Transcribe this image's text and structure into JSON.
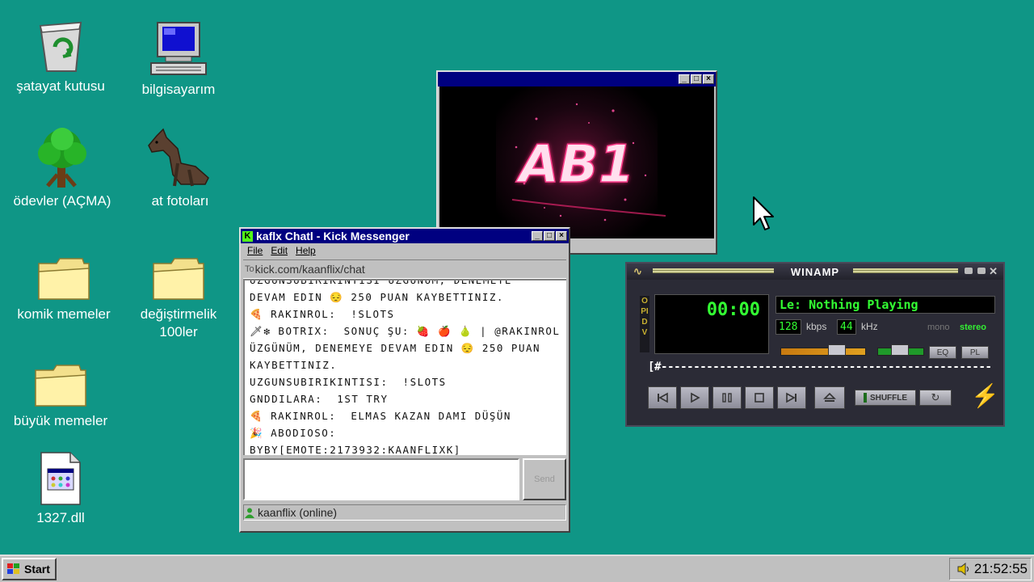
{
  "desktop": {
    "icons": [
      {
        "label": "şatayat kutusu"
      },
      {
        "label": "bilgisayarım"
      },
      {
        "label": "ödevler (AÇMA)"
      },
      {
        "label": "at fotoları"
      },
      {
        "label": "komik memeler"
      },
      {
        "label": "değiştirmelik 100ler"
      },
      {
        "label": "büyük memeler"
      },
      {
        "label": "1327.dll"
      }
    ]
  },
  "video_window": {
    "logo_text": "AB1"
  },
  "chat_window": {
    "title": "kaflx Chatl - Kick Messenger",
    "menu": [
      "File",
      "Edit",
      "Help"
    ],
    "address": "kick.com/kaanflix/chat",
    "messages": [
      "üzgünsübirikintisi üzgünüm, denemeye",
      "devam edin 😔 250 puan kaybettiniz.",
      "🍕 rakinrol:  !slots",
      "🗡❇ botrix:  sonuç şu: 🍓 🍎 🍐 | @rakinrol üzgünüm, denemeye devam edin 😔 250 puan kaybettiniz.",
      "uzgunsubirikintisi:  !slots",
      "gnddilara:  1st try",
      "🍕 rakinrol:  elmas kazan damı düşün",
      "🎉 abodioso:",
      "byby[emote:2173932:kaanflixk]"
    ],
    "send_label": "Send",
    "status_user": "kaanflix (online)"
  },
  "winamp": {
    "title": "WINAMP",
    "side_label": "OPIDV",
    "time": "00:00",
    "track": "Le: Nothing Playing",
    "kbps": "128",
    "kbps_label": "kbps",
    "khz": "44",
    "khz_label": "kHz",
    "mono_label": "mono",
    "stereo_label": "stereo",
    "eq_label": "EQ",
    "pl_label": "PL",
    "seek_text": "[#---------------------------------------------------]",
    "shuffle_label": "SHUFFLE",
    "volume_level": 0.72,
    "balance_level": 0.5,
    "colors": {
      "lcd_green": "#33ff33",
      "panel": "#2b2b36"
    }
  },
  "taskbar": {
    "start_label": "Start",
    "clock": "21:52:55"
  },
  "colors": {
    "desktop": "#0f9686",
    "title_active": "#000080",
    "face": "#c0c0c0"
  }
}
